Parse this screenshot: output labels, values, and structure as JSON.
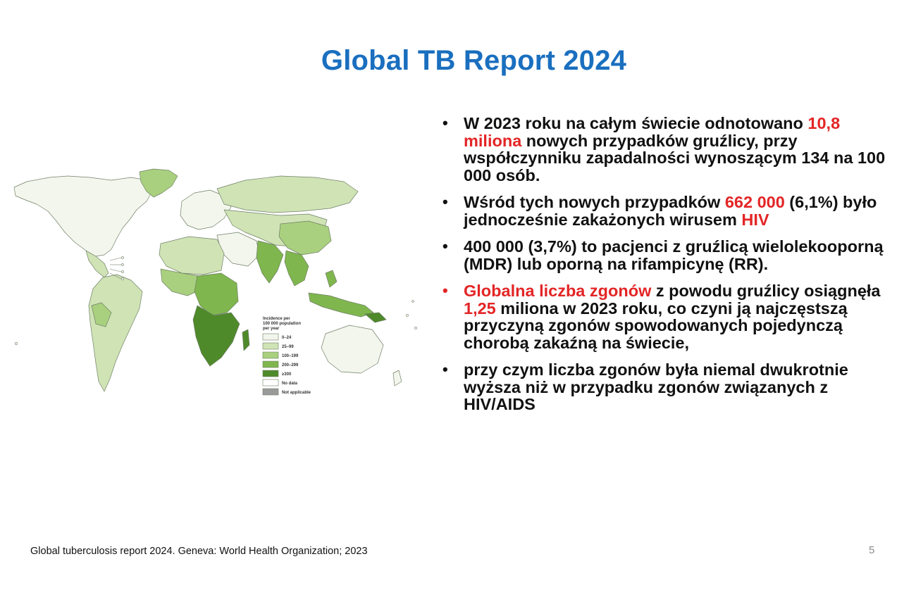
{
  "slide": {
    "title": "Global TB Report 2024",
    "page_number": "5",
    "source": "Global tuberculosis report 2024. Geneva: World Health Organization; 2023"
  },
  "colors": {
    "title_blue": "#1a6fbf",
    "highlight_red": "#e32526",
    "legend": [
      "#f3f6ec",
      "#cfe3b5",
      "#a9d07e",
      "#7fb64e",
      "#4f8a2a",
      "#ffffff",
      "#9a9a9a"
    ]
  },
  "map_legend": {
    "title_lines": [
      "Incidence per",
      "100 000 population",
      "per year"
    ],
    "items": [
      "0–24",
      "25–99",
      "100–199",
      "200–299",
      "≥300",
      "No data",
      "Not applicable"
    ]
  },
  "bullets": [
    {
      "bullet_color": "black",
      "parts": [
        {
          "text": "W 2023 roku na całym świecie odnotowano ",
          "highlight": false
        },
        {
          "text": "10,8 miliona",
          "highlight": true
        },
        {
          "text": " nowych przypadków gruźlicy,  przy współczynniku zapadalności wynoszącym 134 na 100 000 osób.",
          "highlight": false
        }
      ]
    },
    {
      "bullet_color": "black",
      "parts": [
        {
          "text": "Wśród tych nowych przypadków ",
          "highlight": false
        },
        {
          "text": "662 000",
          "highlight": true
        },
        {
          "text": " (6,1%) było jednocześnie zakażonych wirusem ",
          "highlight": false
        },
        {
          "text": "HIV",
          "highlight": true
        }
      ]
    },
    {
      "bullet_color": "black",
      "parts": [
        {
          "text": "400 000 (3,7%) to pacjenci z gruźlicą wielolekooporną (MDR) lub oporną na rifampicynę (RR).",
          "highlight": false
        }
      ]
    },
    {
      "bullet_color": "red",
      "parts": [
        {
          "text": "Globalna liczba zgonów",
          "highlight": true
        },
        {
          "text": " z powodu gruźlicy osiągnęła ",
          "highlight": false
        },
        {
          "text": "1,25",
          "highlight": true
        },
        {
          "text": " miliona w 2023 roku, co czyni ją najczęstszą przyczyną zgonów spowodowanych pojedynczą chorobą zakaźną na świecie,",
          "highlight": false
        }
      ]
    },
    {
      "bullet_color": "black",
      "parts": [
        {
          "text": "przy czym liczba zgonów była niemal dwukrotnie wyższa niż w przypadku zgonów związanych z HIV/AIDS",
          "highlight": false
        }
      ]
    }
  ]
}
